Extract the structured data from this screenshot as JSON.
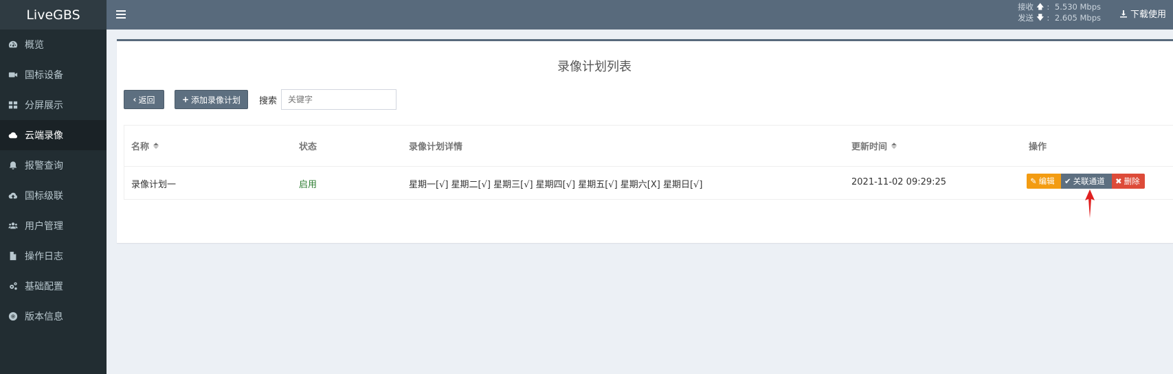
{
  "app": {
    "title": "LiveGBS"
  },
  "sidebar": {
    "items": [
      {
        "label": "概览",
        "icon": "dashboard-icon"
      },
      {
        "label": "国标设备",
        "icon": "video-camera-icon"
      },
      {
        "label": "分屏展示",
        "icon": "grid-icon"
      },
      {
        "label": "云端录像",
        "icon": "cloud-icon",
        "active": true
      },
      {
        "label": "报警查询",
        "icon": "bell-icon"
      },
      {
        "label": "国标级联",
        "icon": "cloud-upload-icon"
      },
      {
        "label": "用户管理",
        "icon": "users-icon"
      },
      {
        "label": "操作日志",
        "icon": "file-icon"
      },
      {
        "label": "基础配置",
        "icon": "gears-icon"
      },
      {
        "label": "版本信息",
        "icon": "lifebuoy-icon"
      }
    ]
  },
  "header": {
    "recv_label": "接收",
    "recv_value": "5.530 Mbps",
    "send_label": "发送",
    "send_value": "2.605 Mbps",
    "download_label": "下载使用"
  },
  "main": {
    "title": "录像计划列表",
    "back_label": "返回",
    "add_label": "添加录像计划",
    "search_label": "搜索",
    "search_placeholder": "关键字",
    "table": {
      "headers": [
        "名称",
        "状态",
        "录像计划详情",
        "更新时间",
        "操作"
      ],
      "rows": [
        {
          "name": "录像计划一",
          "status": "启用",
          "detail": "星期一[√] 星期二[√] 星期三[√] 星期四[√] 星期五[√] 星期六[X] 星期日[√]",
          "updated": "2021-11-02 09:29:25",
          "actions": {
            "edit": "编辑",
            "link": "关联通道",
            "delete": "删除"
          }
        }
      ]
    }
  },
  "colors": {
    "sidebar_bg": "#222d32",
    "header_bg": "#586a7c",
    "edit_btn": "#f39c12",
    "link_btn": "#5d6f80",
    "delete_btn": "#dd4b39",
    "status_enabled": "#2e7d32",
    "annotation_arrow": "#e02020"
  }
}
